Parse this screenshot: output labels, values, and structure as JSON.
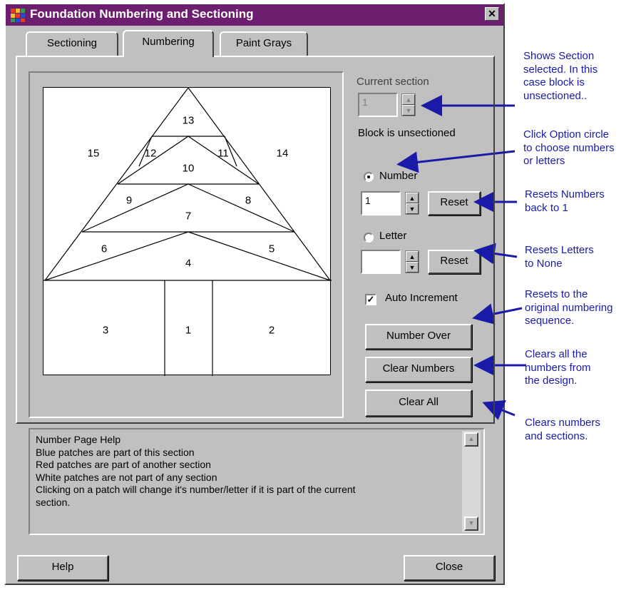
{
  "window": {
    "title": "Foundation Numbering and Sectioning",
    "close_glyph": "✕"
  },
  "tabs": [
    {
      "label": "Sectioning"
    },
    {
      "label": "Numbering",
      "selected": true
    },
    {
      "label": "Paint Grays"
    }
  ],
  "design": {
    "patch_numbers": [
      "1",
      "2",
      "3",
      "4",
      "5",
      "6",
      "7",
      "8",
      "9",
      "10",
      "11",
      "12",
      "13",
      "14",
      "15"
    ]
  },
  "controls": {
    "current_section_label": "Current section",
    "current_section_value": "1",
    "block_status": "Block is unsectioned",
    "number_radio_label": "Number",
    "number_value": "1",
    "number_reset": "Reset",
    "letter_radio_label": "Letter",
    "letter_value": "",
    "letter_reset": "Reset",
    "auto_increment_label": "Auto Increment",
    "auto_increment_checked": true,
    "number_over": "Number Over",
    "clear_numbers": "Clear Numbers",
    "clear_all": "Clear All",
    "selected_mode": "Number"
  },
  "help": {
    "lines": [
      "Number Page Help",
      "Blue patches are part of this section",
      "Red patches are part of another section",
      "White patches are not part of any section",
      "Clicking on a patch will change it's number/letter if it is part of the current",
      "section."
    ]
  },
  "footer": {
    "help_button": "Help",
    "close_button": "Close"
  },
  "annotations": {
    "section": [
      "Shows Section",
      "selected. In this",
      "case block is",
      "unsectioned.."
    ],
    "option": [
      "Click Option circle",
      "to choose numbers",
      "or letters"
    ],
    "reset_numbers": [
      "Resets Numbers",
      "back to 1"
    ],
    "reset_letters": [
      "Resets Letters",
      "to None"
    ],
    "number_over": [
      "Resets to the",
      "original numbering",
      "sequence."
    ],
    "clear_numbers": [
      "Clears all the",
      "numbers from",
      "the design."
    ],
    "clear_all": [
      "Clears numbers",
      "and sections."
    ]
  },
  "colors": {
    "titlebar": "#6b1f6e",
    "annotation": "#1a1aa8",
    "dialog": "#c0c0c0"
  }
}
